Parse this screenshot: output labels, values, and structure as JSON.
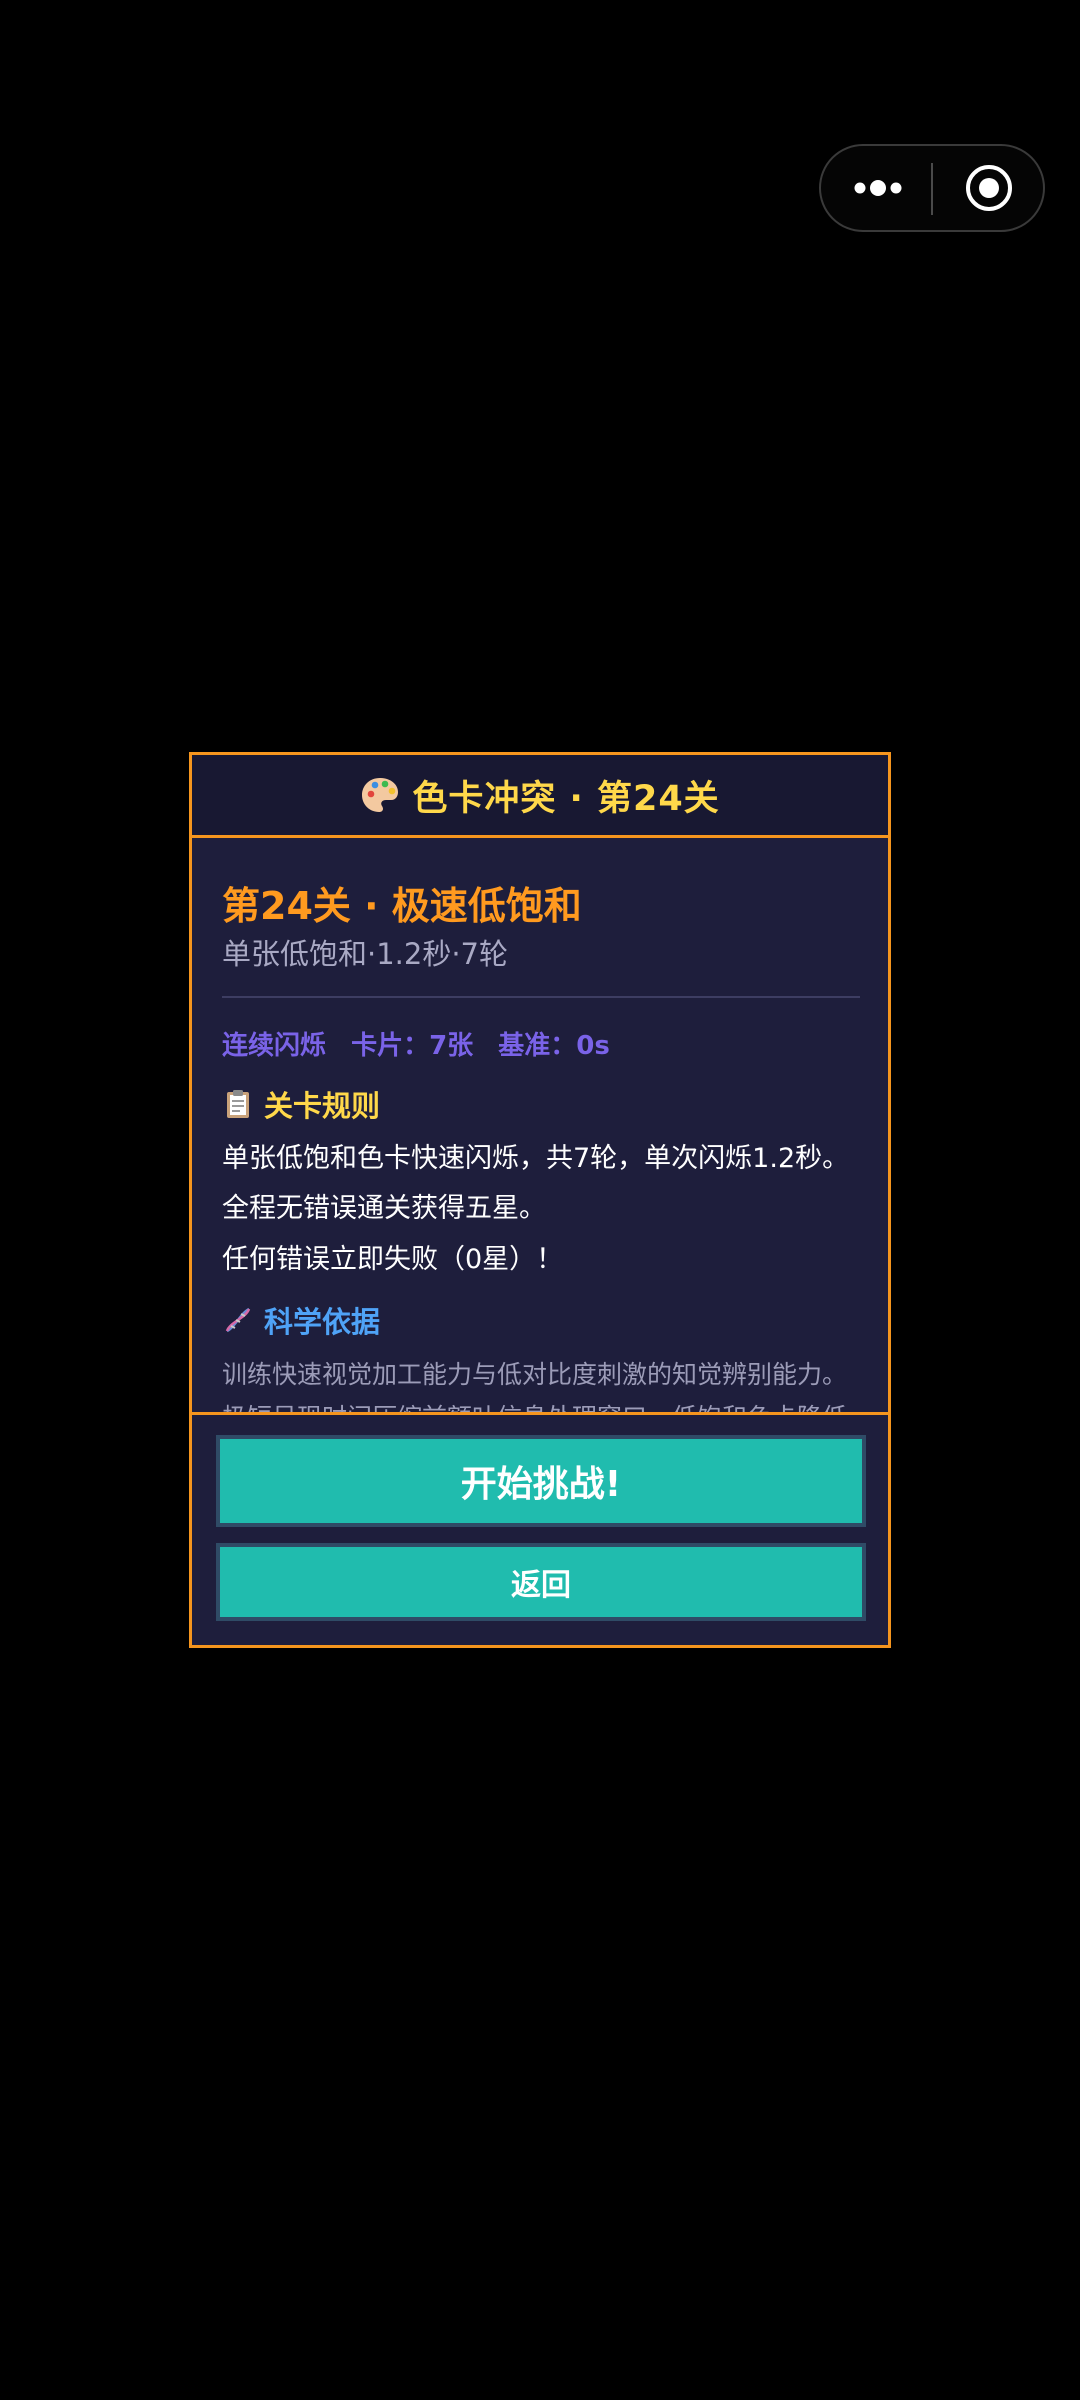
{
  "capsule": {
    "more_icon": "more-dots-icon",
    "close_icon": "target-circle-icon"
  },
  "dialog": {
    "header_icon": "palette-icon",
    "title": "色卡冲突 · 第24关",
    "level_title": "第24关 · 极速低饱和",
    "level_sub": "单张低饱和·1.2秒·7轮",
    "stats": {
      "mode": "连续闪烁",
      "cards": "卡片：7张",
      "baseline": "基准：0s"
    },
    "rules": {
      "icon": "clipboard-icon",
      "heading": "关卡规则",
      "lines": [
        "单张低饱和色卡快速闪烁，共7轮，单次闪烁1.2秒。",
        "全程无错误通关获得五星。",
        "任何错误立即失败（0星）！"
      ]
    },
    "science": {
      "icon": "dna-icon",
      "heading": "科学依据",
      "lines": [
        "训练快速视觉加工能力与低对比度刺激的知觉辨别能力。",
        "极短呈现时间压缩前额叶信息处理窗口，低饱和色卡降低"
      ]
    },
    "buttons": {
      "start": "开始挑战!",
      "back": "返回"
    }
  },
  "colors": {
    "accent_orange": "#f5951e",
    "title_yellow": "#ffd84a",
    "stats_purple": "#7a63e8",
    "science_blue": "#4fa3f7",
    "button_teal": "#20bcae",
    "panel_bg": "#1e1e3c"
  }
}
